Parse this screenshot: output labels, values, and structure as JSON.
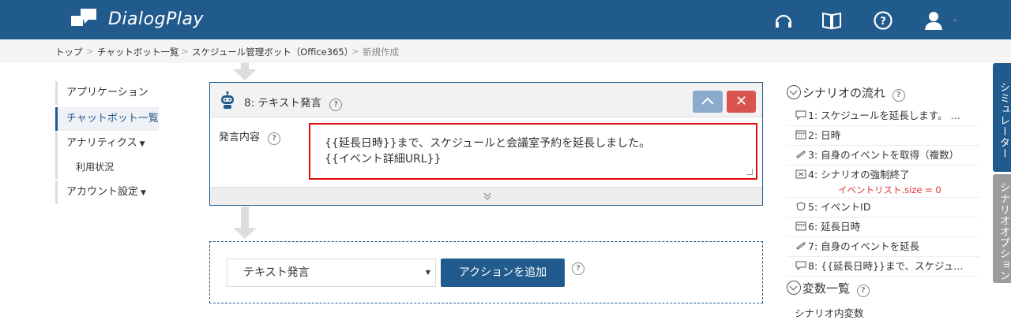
{
  "header": {
    "brand": "DialogPlay",
    "icons": [
      "headset-icon",
      "book-icon",
      "question-icon",
      "user-icon"
    ]
  },
  "breadcrumb": {
    "items": [
      "トップ",
      "チャットボット一覧",
      "スケジュール管理ボット（Office365）",
      "新規作成"
    ],
    "separator": ">"
  },
  "leftnav": {
    "items": [
      "アプリケーション",
      "チャットボット一覧",
      "アナリティクス",
      "利用状況",
      "アカウント設定"
    ]
  },
  "action": {
    "title": "8: テキスト発言",
    "field_label": "発言内容",
    "text_value": "{{延長日時}}まで、スケジュールと会議室予約を延長しました。\n{{イベント詳細URL}}",
    "close_label": "✕"
  },
  "add_action": {
    "select_value": "テキスト発言",
    "add_button": "アクションを追加"
  },
  "right": {
    "flow_title": "シナリオの流れ",
    "flow_items": [
      "1: スケジュールを延長します。 …",
      "2: 日時",
      "3: 自身のイベントを取得（複数）",
      "4: シナリオの強制終了",
      "5: イベントID",
      "6: 延長日時",
      "7: 自身のイベントを延長",
      "8: {{延長日時}}まで、スケジュ…"
    ],
    "flow_note": "イベントリスト.size = 0",
    "vars_title": "変数一覧",
    "vars_sub": "シナリオ内変数"
  },
  "tabs": {
    "simulator": "シミュレーター",
    "options": "シナリオオプション"
  },
  "colors": {
    "primary": "#215a8c",
    "danger": "#d9534f",
    "highlight": "#e00b0b"
  }
}
